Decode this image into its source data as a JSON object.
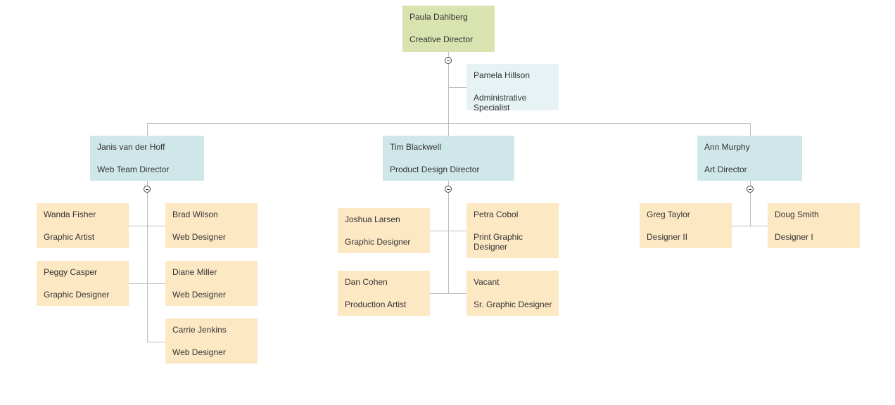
{
  "root": {
    "name": "Paula Dahlberg",
    "title": "Creative Director",
    "color": "#d8e3af"
  },
  "assistant": {
    "name": "Pamela Hillson",
    "title": "Administrative Specialist",
    "color": "#e6f2f4"
  },
  "managers": [
    {
      "name": "Janis van der Hoff",
      "title": "Web Team Director",
      "reports": [
        {
          "name": "Wanda Fisher",
          "title": "Graphic Artist"
        },
        {
          "name": "Brad Wilson",
          "title": "Web Designer"
        },
        {
          "name": "Peggy Casper",
          "title": "Graphic Designer"
        },
        {
          "name": "Diane Miller",
          "title": "Web Designer"
        },
        {
          "name": "Carrie Jenkins",
          "title": "Web Designer"
        }
      ]
    },
    {
      "name": "Tim Blackwell",
      "title": "Product Design Director",
      "reports": [
        {
          "name": "Joshua Larsen",
          "title": "Graphic Designer"
        },
        {
          "name": "Petra Cobol",
          "title": "Print Graphic Designer"
        },
        {
          "name": "Dan Cohen",
          "title": "Production Artist"
        },
        {
          "name": "Vacant",
          "title": "Sr. Graphic Designer"
        }
      ]
    },
    {
      "name": "Ann Murphy",
      "title": "Art Director",
      "reports": [
        {
          "name": "Greg Taylor",
          "title": "Designer II"
        },
        {
          "name": "Doug Smith",
          "title": "Designer I"
        }
      ]
    }
  ],
  "colors": {
    "manager": "#cfe7e9",
    "staff": "#fde8c4",
    "connector": "#bdbdbd"
  },
  "icons": {
    "toggle": "collapse-minus-circle-icon"
  }
}
